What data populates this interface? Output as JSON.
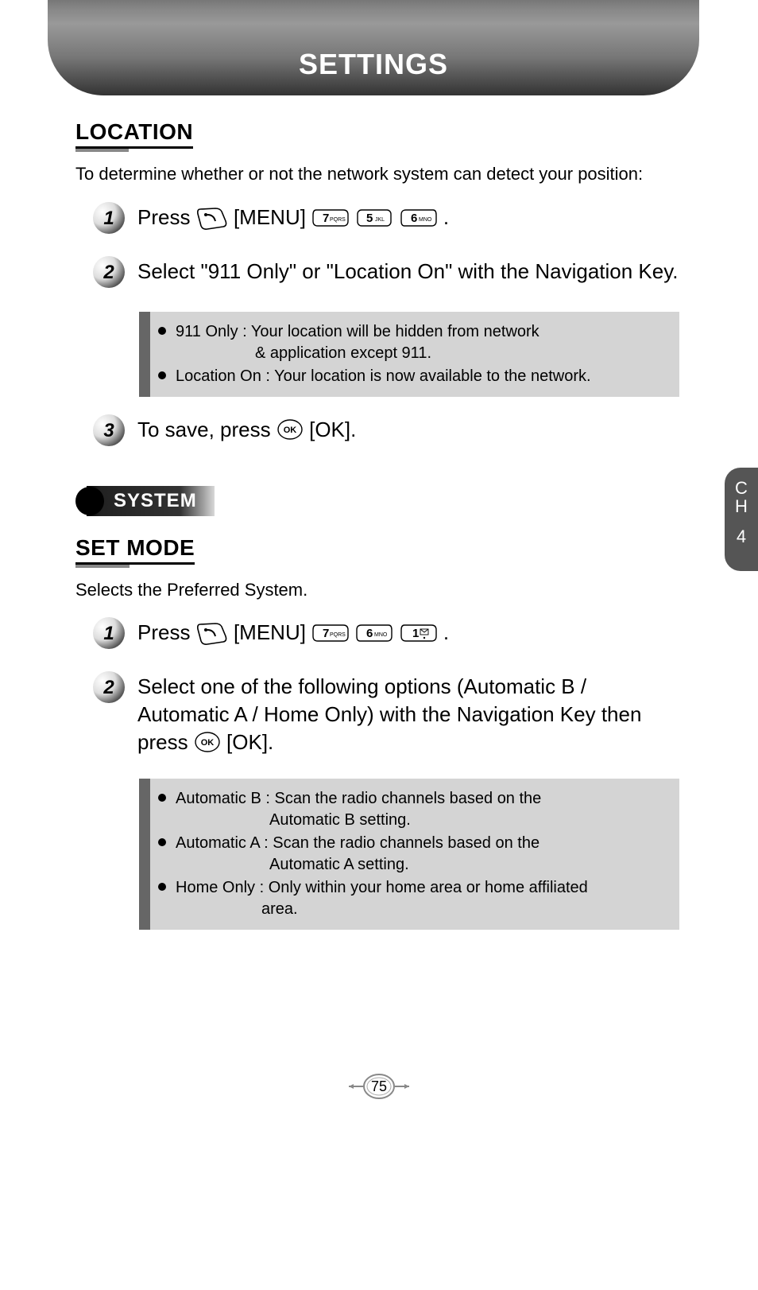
{
  "header": {
    "title": "SETTINGS"
  },
  "location": {
    "heading": "LOCATION",
    "intro": "To determine whether or not the network system can detect your position:",
    "steps": {
      "s1": {
        "press": "Press",
        "menu": "[MENU]",
        "keys": [
          "7 PQRS",
          "5 JKL",
          "6 MNO"
        ],
        "period": "."
      },
      "s2": {
        "text": "Select \"911 Only\" or \"Location On\" with the Navigation Key."
      },
      "note": {
        "b1_line1": "911 Only : Your location will be hidden from network",
        "b1_line2": "& application except 911.",
        "b2": "Location On : Your location is now available to the network."
      },
      "s3": {
        "pre": "To save, press",
        "ok": "[OK].",
        "period": ""
      }
    }
  },
  "system": {
    "tag": "SYSTEM",
    "heading": "SET MODE",
    "intro": "Selects the Preferred System.",
    "steps": {
      "s1": {
        "press": "Press",
        "menu": "[MENU]",
        "keys": [
          "7 PQRS",
          "6 MNO",
          "1"
        ],
        "period": "."
      },
      "s2": {
        "pre": "Select one of the following options (Automatic B / Automatic A / Home Only) with the Navigation Key then press",
        "ok": "[OK]."
      },
      "note": {
        "b1_line1": "Automatic B : Scan the radio channels based on the",
        "b1_line2": "Automatic B setting.",
        "b2_line1": "Automatic A : Scan the radio channels based on the",
        "b2_line2": "Automatic A setting.",
        "b3_line1": "Home Only : Only within your home area or home affiliated",
        "b3_line2": "area."
      }
    }
  },
  "sidebar": {
    "ch_c": "C",
    "ch_h": "H",
    "num": "4"
  },
  "page_number": "75"
}
